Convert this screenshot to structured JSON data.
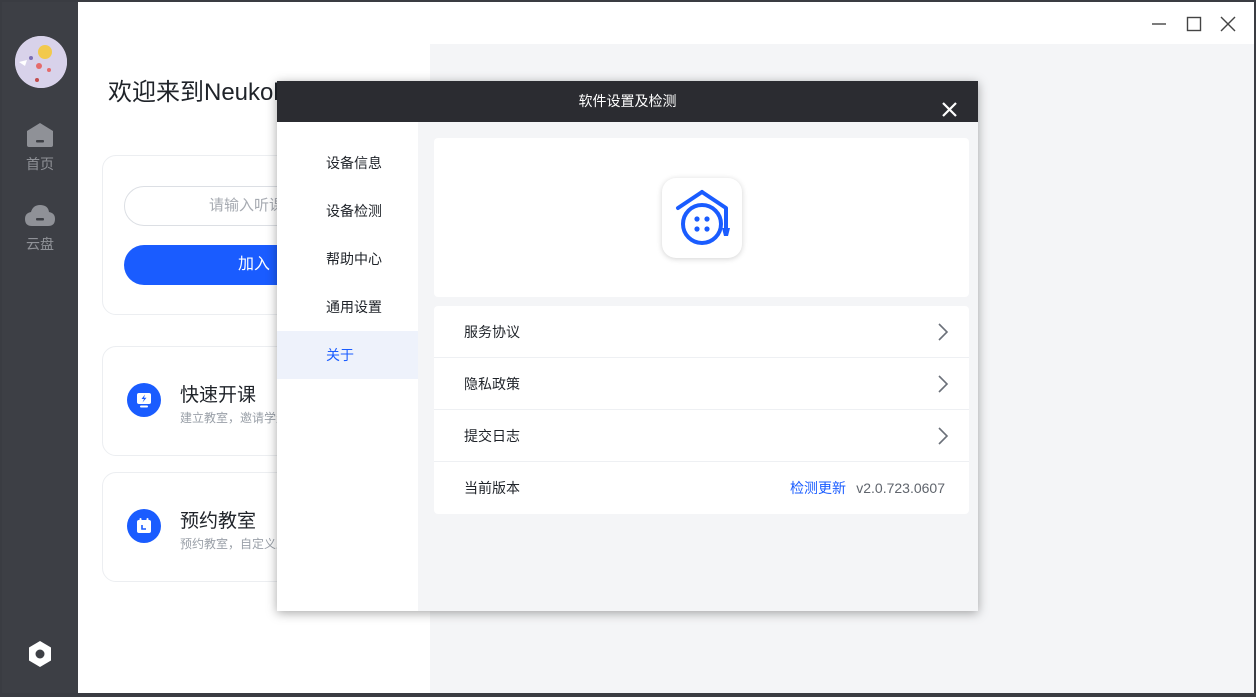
{
  "sidebar": {
    "nav": [
      {
        "label": "首页",
        "icon": "home-icon"
      },
      {
        "label": "云盘",
        "icon": "cloud-icon"
      }
    ],
    "settings_icon": "settings-hexagon-icon"
  },
  "main": {
    "welcome": "欢迎来到Neukol",
    "join_placeholder": "请输入听课",
    "join_button": "加入",
    "features": [
      {
        "title": "快速开课",
        "desc": "建立教室，邀请学生",
        "icon": "lightning-screen-icon"
      },
      {
        "title": "预约教室",
        "desc": "预约教室，自定义上",
        "icon": "calendar-icon"
      }
    ]
  },
  "window": {
    "controls": [
      "minimize-icon",
      "maximize-icon",
      "close-icon"
    ]
  },
  "dialog": {
    "title": "软件设置及检测",
    "nav": [
      {
        "label": "设备信息",
        "active": false
      },
      {
        "label": "设备检测",
        "active": false
      },
      {
        "label": "帮助中心",
        "active": false
      },
      {
        "label": "通用设置",
        "active": false
      },
      {
        "label": "关于",
        "active": true
      }
    ],
    "rows": [
      {
        "label": "服务协议"
      },
      {
        "label": "隐私政策"
      },
      {
        "label": "提交日志"
      },
      {
        "label": "当前版本",
        "link": "检测更新",
        "version": "v2.0.723.0607"
      }
    ]
  },
  "colors": {
    "accent": "#1a5cff",
    "sidebar": "#3d3f45",
    "dialog_header": "#2b2c31"
  }
}
